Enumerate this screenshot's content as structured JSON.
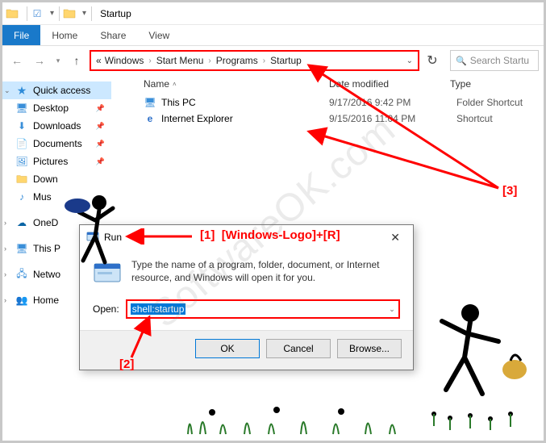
{
  "titlebar": {
    "title": "Startup"
  },
  "ribbon": {
    "file": "File",
    "home": "Home",
    "share": "Share",
    "view": "View"
  },
  "breadcrumb": {
    "items": [
      "Windows",
      "Start Menu",
      "Programs",
      "Startup"
    ],
    "prefix": "«"
  },
  "search": {
    "placeholder": "Search Startu"
  },
  "sidebar": {
    "quick_access": "Quick access",
    "items": [
      {
        "label": "Desktop",
        "pinned": true
      },
      {
        "label": "Downloads",
        "pinned": true
      },
      {
        "label": "Documents",
        "pinned": true
      },
      {
        "label": "Pictures",
        "pinned": true
      },
      {
        "label": "Down",
        "pinned": false
      },
      {
        "label": "Mus",
        "pinned": false
      }
    ],
    "onedrive": "OneD",
    "thispc": "This P",
    "network": "Netwo",
    "homegroup": "Home"
  },
  "columns": {
    "name": "Name",
    "date": "Date modified",
    "type": "Type"
  },
  "files": [
    {
      "name": "This PC",
      "date": "9/17/2016 9:42 PM",
      "type": "Folder Shortcut",
      "icon": "pc"
    },
    {
      "name": "Internet Explorer",
      "date": "9/15/2016 11:04 PM",
      "type": "Shortcut",
      "icon": "ie"
    }
  ],
  "run": {
    "title": "Run",
    "desc": "Type the name of a program, folder, document, or Internet resource, and Windows will open it for you.",
    "open_label": "Open:",
    "value": "shell:startup",
    "ok": "OK",
    "cancel": "Cancel",
    "browse": "Browse..."
  },
  "annotations": {
    "a1": "[1]",
    "a1_text": "[Windows-Logo]+[R]",
    "a2": "[2]",
    "a3": "[3]"
  },
  "watermark": "SoftwareOK.com"
}
